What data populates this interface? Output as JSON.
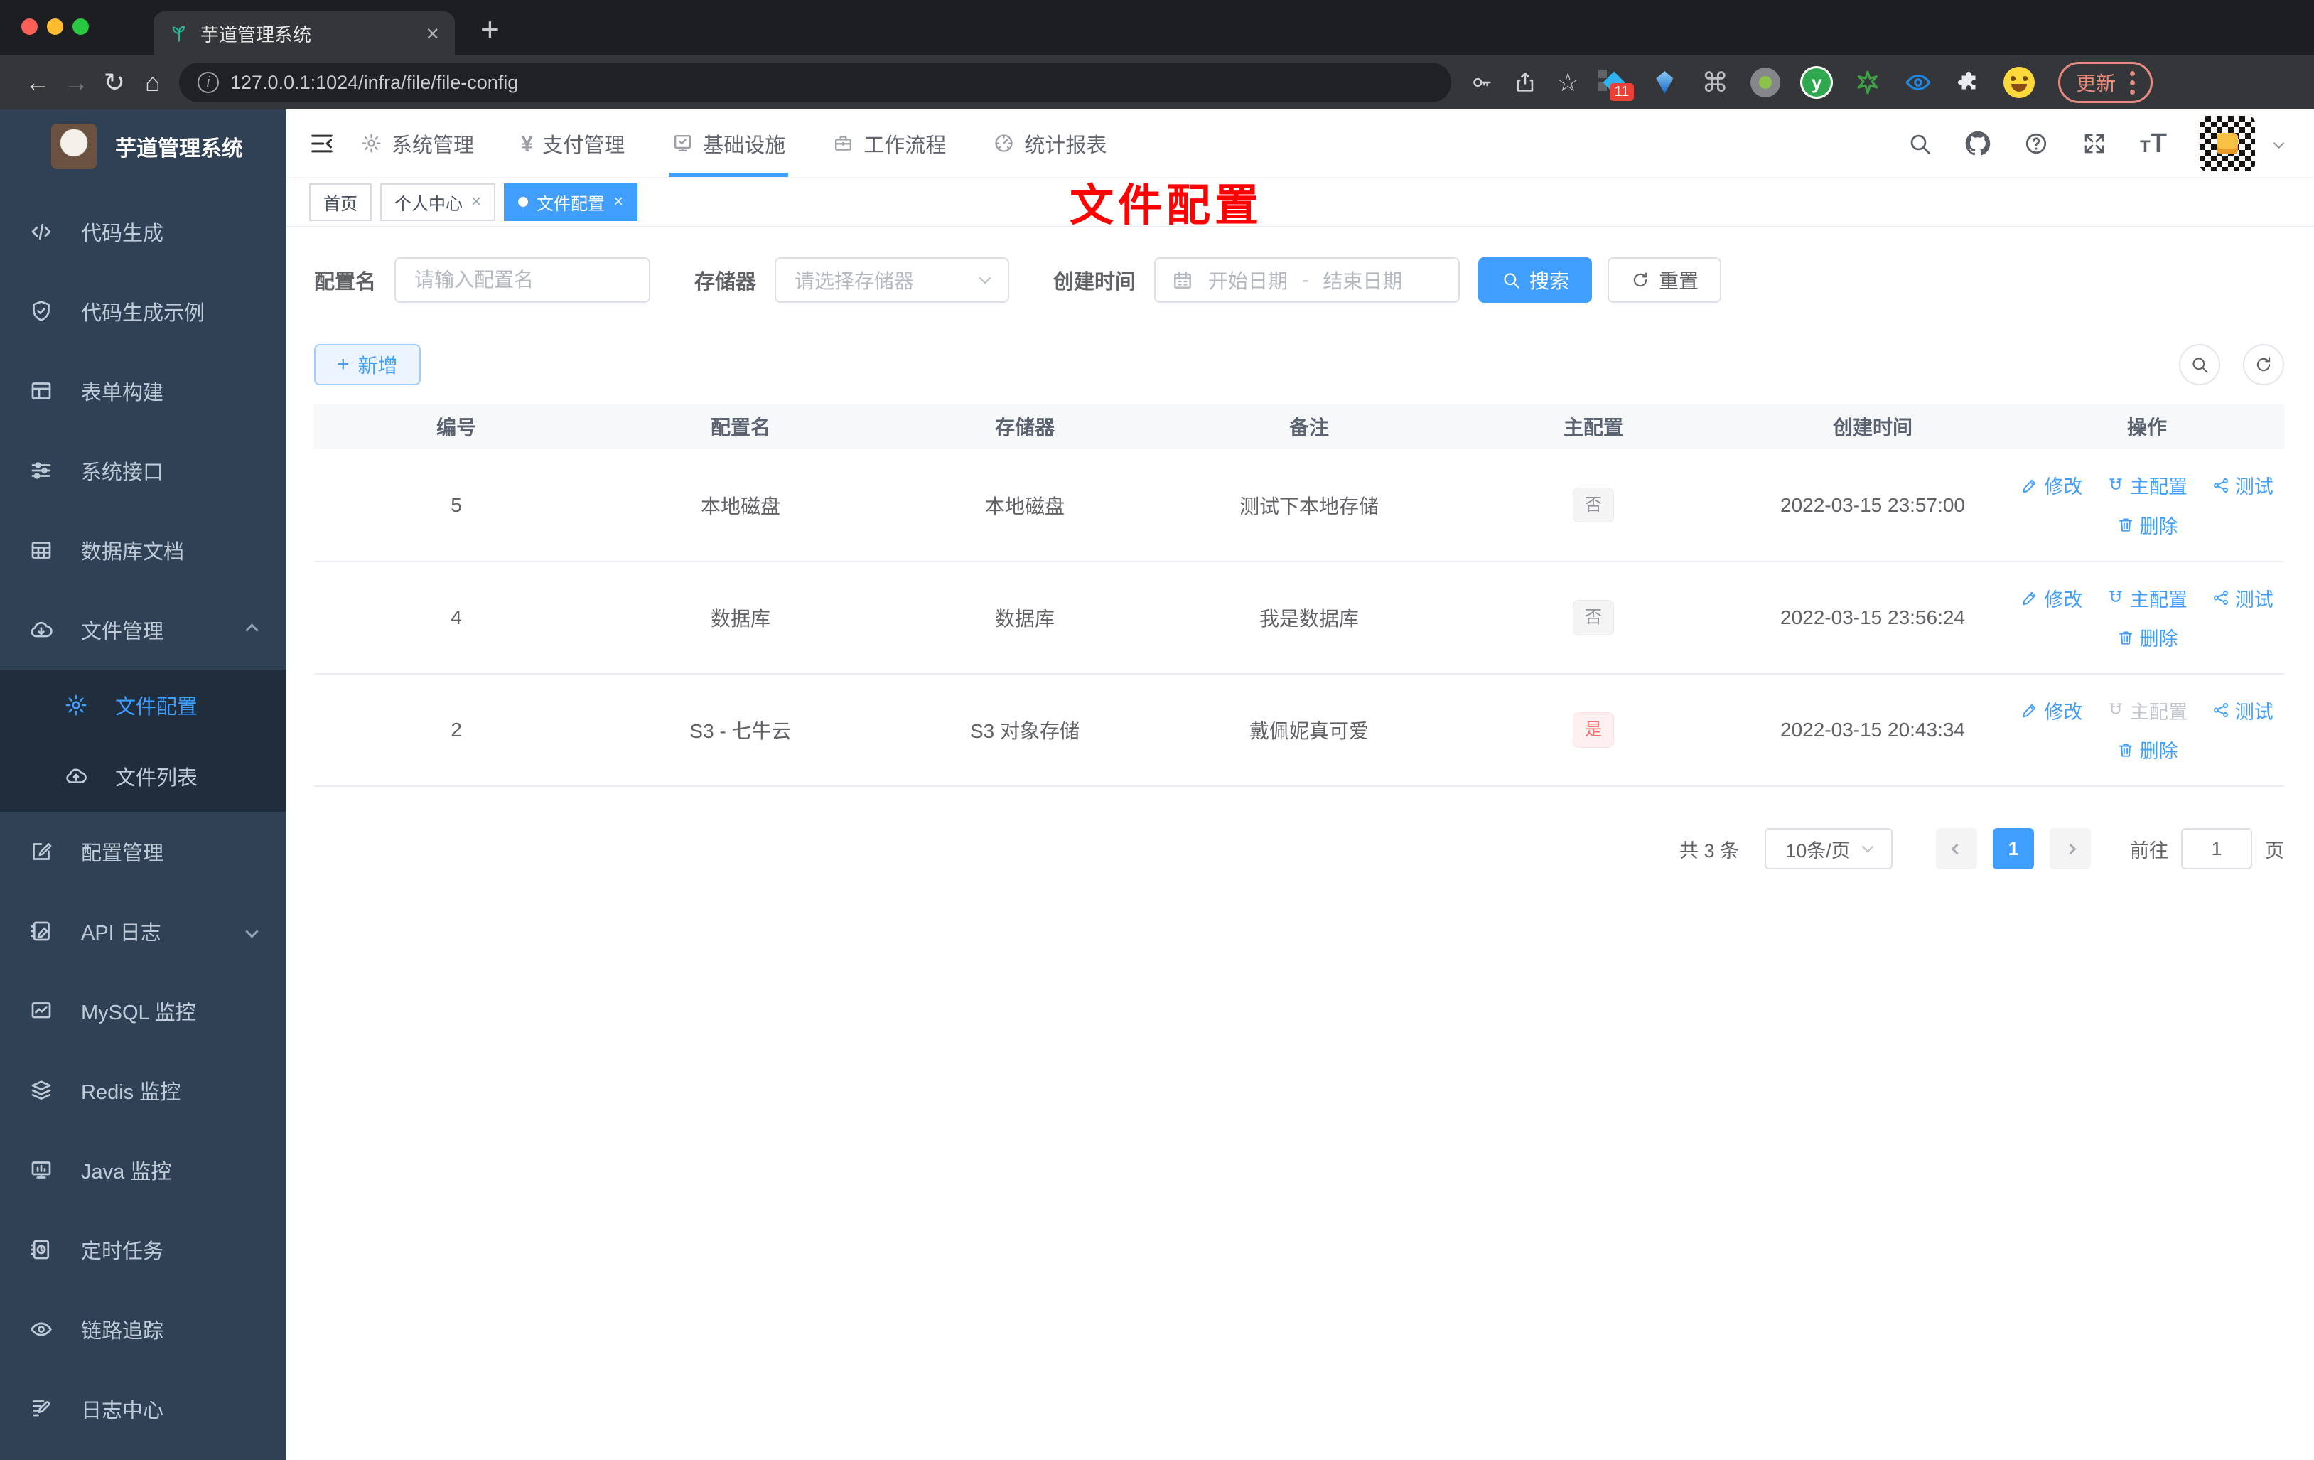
{
  "browser": {
    "tab_title": "芋道管理系统",
    "url": "127.0.0.1:1024/infra/file/file-config",
    "update_label": "更新",
    "extensions_badge": "11"
  },
  "app": {
    "logo_title": "芋道管理系统",
    "annotation": "文件配置"
  },
  "topnav": {
    "items": [
      {
        "label": "系统管理",
        "icon": "gear-icon"
      },
      {
        "label": "支付管理",
        "icon": "yen-icon"
      },
      {
        "label": "基础设施",
        "icon": "monitor-check-icon",
        "active": true
      },
      {
        "label": "工作流程",
        "icon": "briefcase-icon"
      },
      {
        "label": "统计报表",
        "icon": "gauge-icon"
      }
    ]
  },
  "sidebar": {
    "items": [
      {
        "label": "代码生成",
        "icon": "code-icon"
      },
      {
        "label": "代码生成示例",
        "icon": "shield-check-icon"
      },
      {
        "label": "表单构建",
        "icon": "form-icon"
      },
      {
        "label": "系统接口",
        "icon": "sliders-icon"
      },
      {
        "label": "数据库文档",
        "icon": "db-table-icon"
      },
      {
        "label": "文件管理",
        "icon": "cloud-download-icon",
        "expanded": true
      },
      {
        "label": "文件配置",
        "icon": "gear-icon",
        "active": true,
        "sub": true
      },
      {
        "label": "文件列表",
        "icon": "cloud-upload-icon",
        "sub": true
      },
      {
        "label": "配置管理",
        "icon": "edit-square-icon"
      },
      {
        "label": "API 日志",
        "icon": "log-pen-icon",
        "collapsed": true
      },
      {
        "label": "MySQL 监控",
        "icon": "chart-monitor-icon"
      },
      {
        "label": "Redis 监控",
        "icon": "layers-icon"
      },
      {
        "label": "Java 监控",
        "icon": "java-monitor-icon"
      },
      {
        "label": "定时任务",
        "icon": "timer-icon"
      },
      {
        "label": "链路追踪",
        "icon": "eye-icon"
      },
      {
        "label": "日志中心",
        "icon": "note-pen-icon"
      }
    ]
  },
  "tags": {
    "items": [
      {
        "label": "首页",
        "closable": false,
        "active": false
      },
      {
        "label": "个人中心",
        "closable": true,
        "active": false
      },
      {
        "label": "文件配置",
        "closable": true,
        "active": true
      }
    ]
  },
  "filters": {
    "name_label": "配置名",
    "name_placeholder": "请输入配置名",
    "storage_label": "存储器",
    "storage_placeholder": "请选择存储器",
    "time_label": "创建时间",
    "start_placeholder": "开始日期",
    "range_separator": "-",
    "end_placeholder": "结束日期",
    "search_label": "搜索",
    "reset_label": "重置"
  },
  "toolbar": {
    "add_label": "新增"
  },
  "table": {
    "columns": [
      "编号",
      "配置名",
      "存储器",
      "备注",
      "主配置",
      "创建时间",
      "操作"
    ],
    "action_labels": {
      "edit": "修改",
      "master": "主配置",
      "test": "测试",
      "delete": "删除"
    },
    "rows": [
      {
        "id": "5",
        "name": "本地磁盘",
        "storage": "本地磁盘",
        "remark": "测试下本地存储",
        "master": "否",
        "master_type": "info",
        "created": "2022-03-15 23:57:00",
        "master_action_disabled": false
      },
      {
        "id": "4",
        "name": "数据库",
        "storage": "数据库",
        "remark": "我是数据库",
        "master": "否",
        "master_type": "info",
        "created": "2022-03-15 23:56:24",
        "master_action_disabled": false
      },
      {
        "id": "2",
        "name": "S3 - 七牛云",
        "storage": "S3 对象存储",
        "remark": "戴佩妮真可爱",
        "master": "是",
        "master_type": "danger",
        "created": "2022-03-15 20:43:34",
        "master_action_disabled": true
      }
    ]
  },
  "pagination": {
    "total": "共 3 条",
    "page_size": "10条/页",
    "current_page": "1",
    "goto_label": "前往",
    "goto_value": "1",
    "page_unit": "页"
  },
  "colors": {
    "primary": "#409eff",
    "sidebar_bg": "#304156",
    "submenu_bg": "#1f2d3d",
    "info_tag_text": "#909399",
    "danger_tag_text": "#f56c6c",
    "annotation_red": "#fe0100"
  }
}
